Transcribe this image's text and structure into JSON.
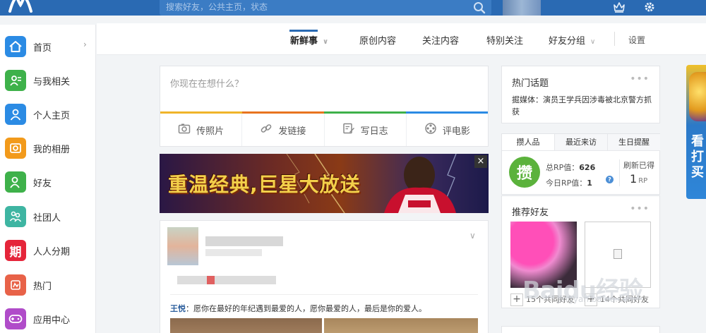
{
  "topbar": {
    "search_placeholder": "搜索好友，公共主页，状态"
  },
  "sidebar": {
    "items": [
      {
        "label": "首页",
        "color": "#2b8be4",
        "glyph": "⌂",
        "arrow": "›"
      },
      {
        "label": "与我相关",
        "color": "#3eb14a",
        "glyph": "☰"
      },
      {
        "label": "个人主页",
        "color": "#2b8be4",
        "glyph": "♟"
      },
      {
        "label": "我的相册",
        "color": "#f29a1b",
        "glyph": "▣"
      },
      {
        "label": "好友",
        "color": "#3eb14a",
        "glyph": "♟"
      },
      {
        "label": "社团人",
        "color": "#3eb5a2",
        "glyph": "♝"
      },
      {
        "label": "人人分期",
        "color": "#e5253a",
        "glyph": "期"
      },
      {
        "label": "热门",
        "color": "#e86248",
        "glyph": "☝"
      },
      {
        "label": "应用中心",
        "color": "#b04cc9",
        "glyph": "◉"
      }
    ]
  },
  "subnav": {
    "tabs": [
      "新鲜事",
      "原创内容",
      "关注内容",
      "特别关注",
      "好友分组"
    ],
    "settings": "设置"
  },
  "composer": {
    "placeholder": "你现在在想什么？",
    "strip_colors": [
      "#f0b42a",
      "#e8741f",
      "#3eb14a",
      "#2b8be4"
    ],
    "actions": [
      "传照片",
      "发链接",
      "写日志",
      "评电影"
    ]
  },
  "banner": {
    "text": "重温经典,巨星大放送",
    "close": "×"
  },
  "feed": {
    "author": "王悦",
    "text": "：愿你在最好的年纪遇到最爱的人，愿你最爱的人，最后是你的爱人。"
  },
  "hot_topics": {
    "title": "热门话题",
    "more": "•••",
    "headline": "掘媒体：演员王学兵因涉毒被北京警方抓获"
  },
  "rp": {
    "tabs": [
      "攒人品",
      "最近来访",
      "生日提醒"
    ],
    "badge": "攒",
    "total_label": "总RP值：",
    "total_value": "626",
    "today_label": "今日RP值：",
    "today_value": "1",
    "help": "?",
    "refresh_label": "刷新已得",
    "refresh_value": "1",
    "refresh_unit": "RP"
  },
  "recommend": {
    "title": "推荐好友",
    "more": "•••",
    "friends": [
      {
        "mutual": "15个共同好友"
      },
      {
        "mutual": "14个共同好友"
      }
    ]
  },
  "watermark": {
    "text": "Baidu经验",
    "url": "jingyan.baidu.com"
  },
  "edge_ad": {
    "text": "看打买"
  }
}
